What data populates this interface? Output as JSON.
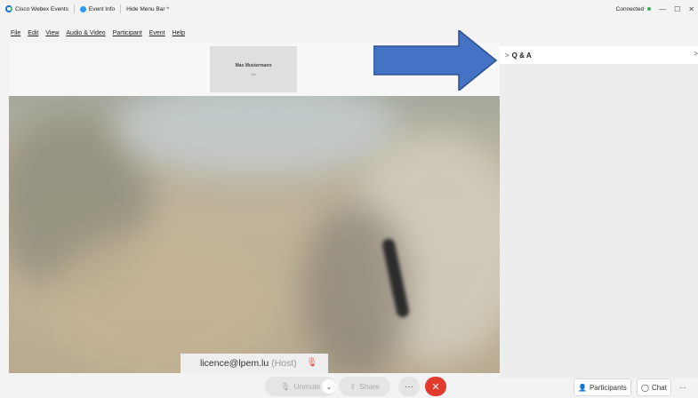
{
  "titlebar": {
    "app_name": "Cisco Webex Events",
    "event_info": "Event Info",
    "hide_menu": "Hide Menu Bar ^",
    "status": "Connected",
    "min": "—",
    "max": "☐"
  },
  "menu": [
    "File",
    "Edit",
    "View",
    "Audio & Video",
    "Participant",
    "Event",
    "Help"
  ],
  "self_view": {
    "name": "Max Mustermann",
    "sub": "Me"
  },
  "speaker": {
    "name": "licence@lpem.lu",
    "role": "(Host)"
  },
  "controls": {
    "unmute": "Unmute",
    "share": "Share",
    "more": "···",
    "leave": "✕"
  },
  "panel": {
    "title": "Q & A",
    "caret": ">",
    "close_mark": ">"
  },
  "panel_buttons": {
    "participants": "Participants",
    "chat": "Chat",
    "more": "···"
  },
  "colors": {
    "accent": "#1d76d0",
    "leave": "#e23b2e",
    "connected": "#2fb356",
    "arrow": "#4472c4"
  }
}
